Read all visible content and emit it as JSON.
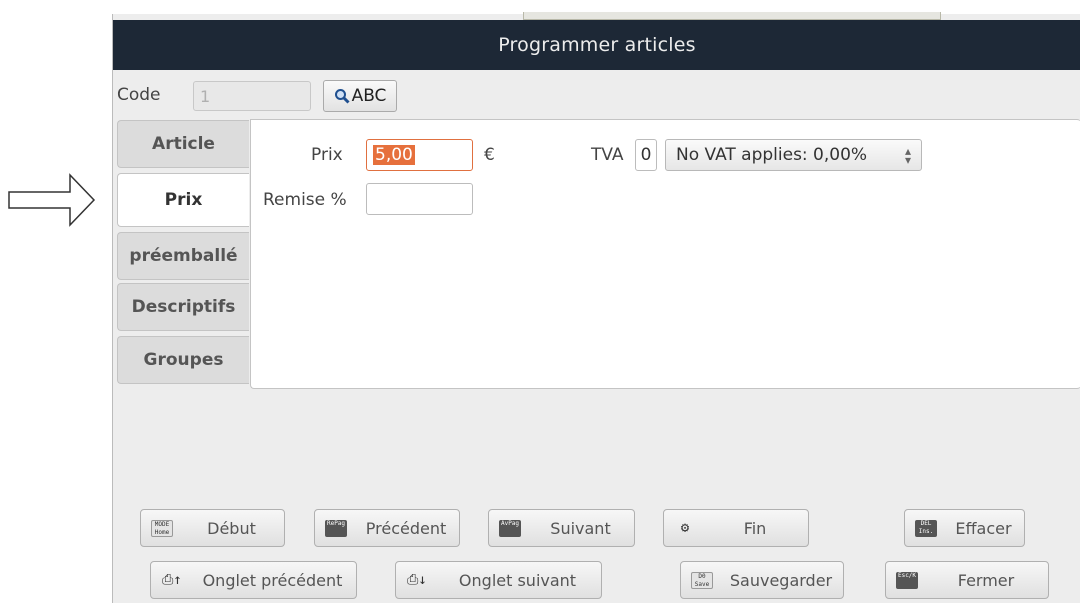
{
  "window": {
    "title": "Programmer articles"
  },
  "code": {
    "label": "Code",
    "value": "1",
    "search_button": "ABC"
  },
  "tabs": [
    {
      "label": "Article",
      "active": false
    },
    {
      "label": "Prix",
      "active": true
    },
    {
      "label": "préemballé",
      "active": false
    },
    {
      "label": "Descriptifs",
      "active": false
    },
    {
      "label": "Groupes",
      "active": false
    }
  ],
  "price_tab": {
    "prix_label": "Prix",
    "prix_value": "5,00",
    "currency": "€",
    "tva_label": "TVA",
    "tva_code": "0",
    "vat_option": "No VAT applies: 0,00%",
    "remise_label": "Remise %",
    "remise_value": ""
  },
  "buttons": {
    "debut": {
      "label": "Début",
      "key": "MODE\nHome"
    },
    "precedent": {
      "label": "Précédent",
      "key": "RePag"
    },
    "suivant": {
      "label": "Suivant",
      "key": "AvPag"
    },
    "fin": {
      "label": "Fin",
      "key": "⚙"
    },
    "effacer": {
      "label": "Effacer",
      "key": "DEL\nIns."
    },
    "onglet_precedent": {
      "label": "Onglet précédent",
      "key": "⎙↑"
    },
    "onglet_suivant": {
      "label": "Onglet suivant",
      "key": "⎙↓"
    },
    "sauvegarder": {
      "label": "Sauvegarder",
      "key": "D0\nSave"
    },
    "fermer": {
      "label": "Fermer",
      "key": "Esc/K"
    }
  },
  "colors": {
    "titlebar": "#1d2836",
    "selection": "#e6703c",
    "focus_border": "#e07040"
  }
}
